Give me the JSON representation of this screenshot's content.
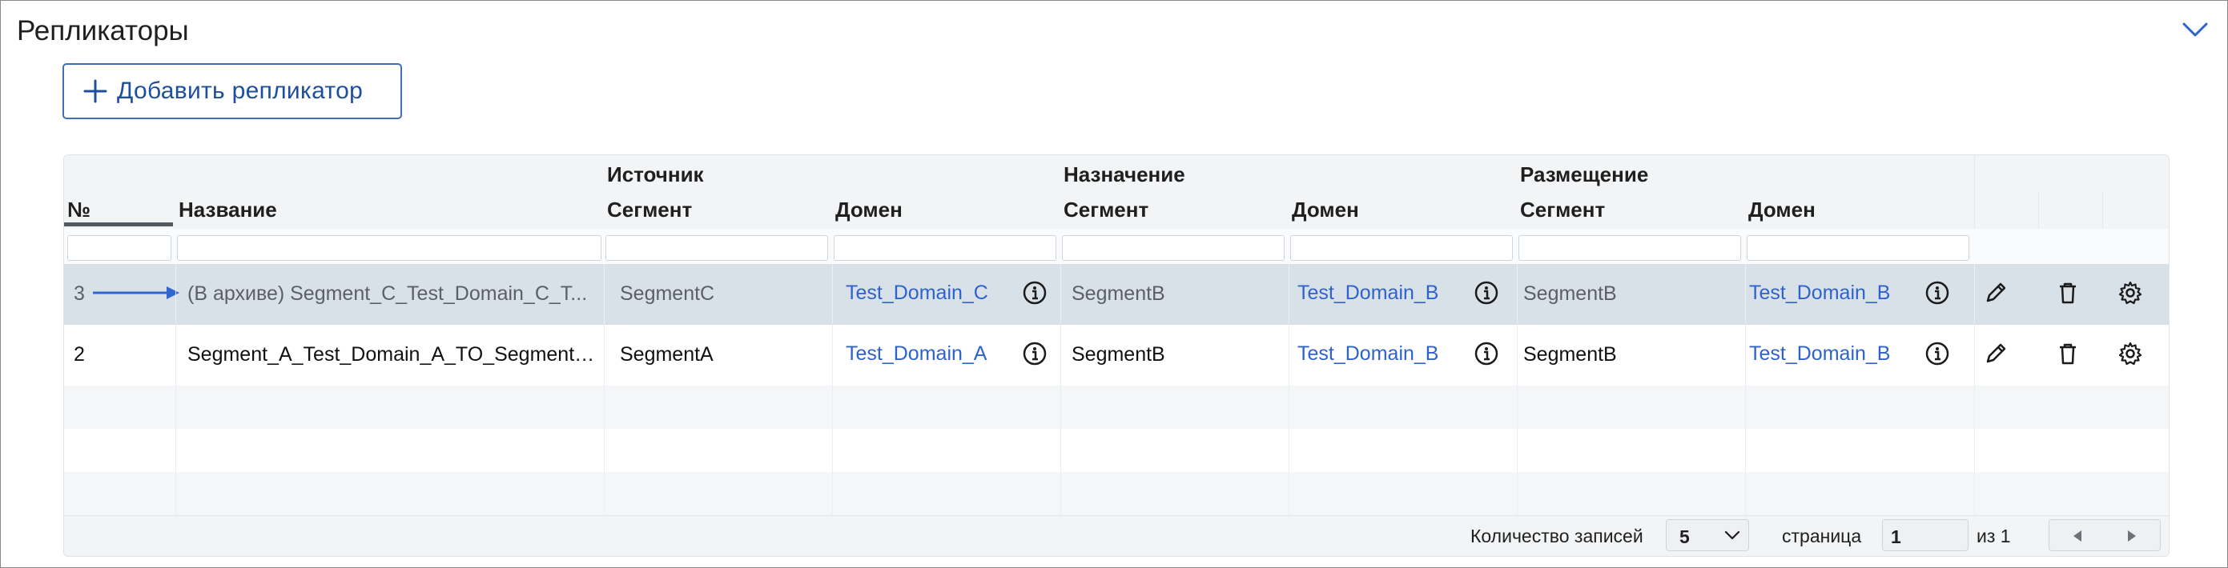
{
  "section": {
    "title": "Репликаторы",
    "add_button_label": "Добавить репликатор"
  },
  "table": {
    "group_headers": {
      "source": "Источник",
      "destination": "Назначение",
      "placement": "Размещение"
    },
    "columns": {
      "number": "№",
      "name": "Название",
      "source_segment": "Сегмент",
      "source_domain": "Домен",
      "dest_segment": "Сегмент",
      "dest_domain": "Домен",
      "place_segment": "Сегмент",
      "place_domain": "Домен"
    },
    "rows": [
      {
        "number": "3",
        "name": "(В архиве) Segment_C_Test_Domain_C_T...",
        "source_segment": "SegmentC",
        "source_domain": "Test_Domain_C",
        "dest_segment": "SegmentB",
        "dest_domain": "Test_Domain_B",
        "place_segment": "SegmentB",
        "place_domain": "Test_Domain_B",
        "archived": true,
        "selected": true
      },
      {
        "number": "2",
        "name": "Segment_A_Test_Domain_A_TO_Segment_...",
        "source_segment": "SegmentA",
        "source_domain": "Test_Domain_A",
        "dest_segment": "SegmentB",
        "dest_domain": "Test_Domain_B",
        "place_segment": "SegmentB",
        "place_domain": "Test_Domain_B",
        "archived": false,
        "selected": false
      }
    ]
  },
  "pagination": {
    "records_label": "Количество записей",
    "page_size": "5",
    "page_label": "страница",
    "page_value": "1",
    "of_label": "из 1"
  },
  "colors": {
    "accent": "#2e62cc",
    "selected_row": "#d9e1e8",
    "header_bg": "#f2f4f6"
  },
  "icons": [
    "plus-icon",
    "chevron-down-icon",
    "info-icon",
    "pencil-icon",
    "trash-icon",
    "gear-icon",
    "arrow-right-icon",
    "caret-left-icon",
    "caret-right-icon"
  ]
}
